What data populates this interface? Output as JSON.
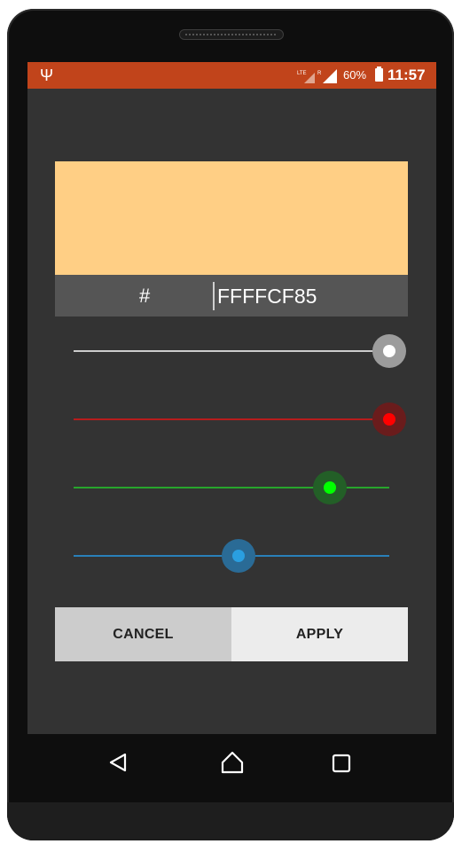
{
  "status_bar": {
    "battery_percent": "60%",
    "time": "11:57",
    "usb_icon": "usb-icon",
    "lte_label": "LTE",
    "r_label": "R"
  },
  "color_picker": {
    "preview_color": "#FFCF85",
    "hash_label": "#",
    "hex_value": "FFFFCF85",
    "sliders": [
      {
        "name": "alpha",
        "value": 255,
        "max": 255,
        "color": "#cccccc",
        "halo": "#9c9c9c",
        "knob": "#ffffff"
      },
      {
        "name": "red",
        "value": 255,
        "max": 255,
        "color": "#b71c1c",
        "halo": "#6a1c1c",
        "knob": "#ff0000"
      },
      {
        "name": "green",
        "value": 207,
        "max": 255,
        "color": "#27a52c",
        "halo": "#235f27",
        "knob": "#00ff00"
      },
      {
        "name": "blue",
        "value": 133,
        "max": 255,
        "color": "#2980b9",
        "halo": "#2a6b96",
        "knob": "#2a9fe0"
      }
    ]
  },
  "buttons": {
    "cancel": "CANCEL",
    "apply": "APPLY"
  },
  "nav_bar": {
    "back": "back-icon",
    "home": "home-icon",
    "recents": "recents-icon"
  }
}
